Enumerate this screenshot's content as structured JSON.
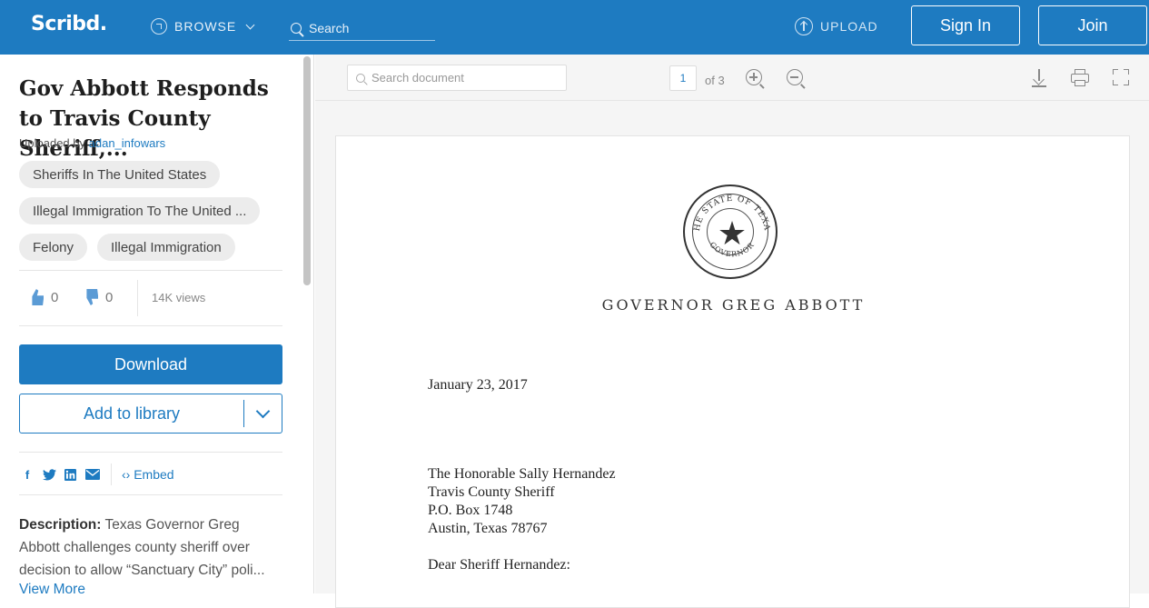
{
  "header": {
    "logo": "Scribd.",
    "browse_label": "BROWSE",
    "search_placeholder": "Search",
    "upload_label": "UPLOAD",
    "signin_label": "Sign In",
    "join_label": "Join",
    "brand_color": "#1e7bc1"
  },
  "document": {
    "title": "Gov Abbott Responds to Travis County Sheriff,...",
    "uploaded_by_prefix": "Uploaded by",
    "uploader": "adan_infowars",
    "tags": [
      "Sheriffs In The United States",
      "Illegal Immigration To The United ...",
      "Felony",
      "Illegal Immigration"
    ],
    "likes": "0",
    "dislikes": "0",
    "views": "14K views",
    "download_label": "Download",
    "add_library_label": "Add to library",
    "embed_label": "Embed",
    "description_label": "Description:",
    "description_text": " Texas Governor Greg Abbott challenges county sheriff over decision to allow “Sanctuary City” poli...",
    "view_more": "View More"
  },
  "viewer": {
    "search_placeholder": "Search document",
    "page_current": "1",
    "page_total": "of 3"
  },
  "letter": {
    "seal_text": "THE STATE OF TEXAS",
    "seal_bottom": "GOVERNOR",
    "letterhead": "GOVERNOR GREG ABBOTT",
    "date": "January 23, 2017",
    "addressee": "The Honorable Sally Hernandez",
    "addr_line2": "Travis County Sheriff",
    "addr_line3": "P.O. Box 1748",
    "addr_line4": "Austin, Texas  78767",
    "salutation": "Dear Sheriff Hernandez:"
  }
}
